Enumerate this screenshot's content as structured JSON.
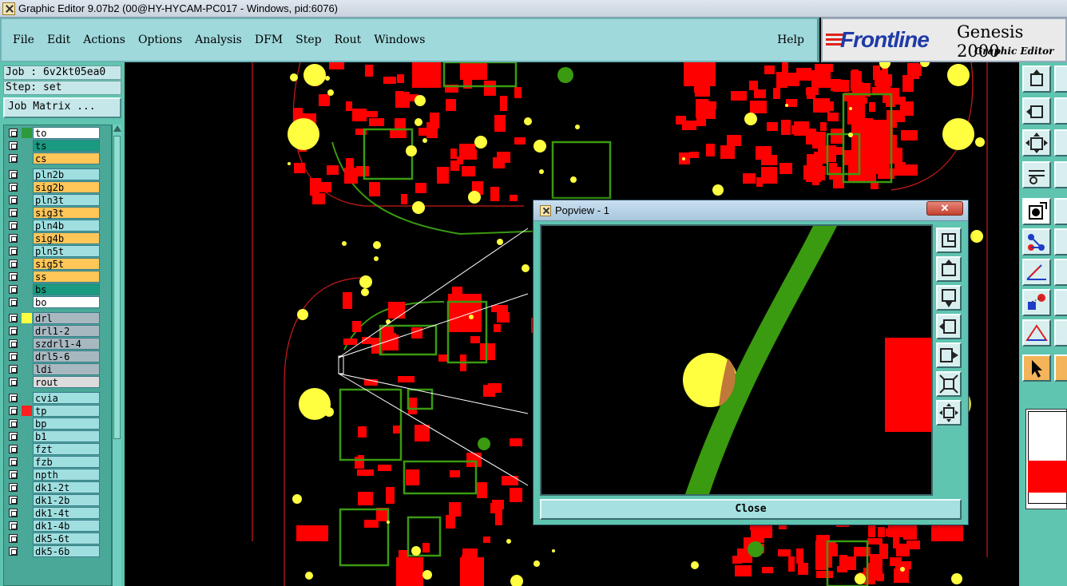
{
  "window": {
    "title": "Graphic Editor 9.07b2 (00@HY-HYCAM-PC017 - Windows, pid:6076)"
  },
  "menu": {
    "items": [
      "File",
      "Edit",
      "Actions",
      "Options",
      "Analysis",
      "DFM",
      "Step",
      "Rout",
      "Windows"
    ],
    "help": "Help"
  },
  "brand": {
    "logo": "Frontline",
    "product": "Genesis 2000",
    "subtitle": "Graphic Editor"
  },
  "job": {
    "job_line": "Job : 6v2kt05ea0",
    "step_line": "Step: set",
    "matrix_button": "Job Matrix ..."
  },
  "layers": [
    {
      "name": "to",
      "color": "#ffffff",
      "swatch": "#2e9a3c"
    },
    {
      "name": "ts",
      "color": "#1a9a80",
      "swatch": ""
    },
    {
      "name": "cs",
      "color": "#ffc658",
      "swatch": ""
    },
    {
      "name": "pln2b",
      "color": "#9fdfe0",
      "swatch": ""
    },
    {
      "name": "sig2b",
      "color": "#ffc658",
      "swatch": ""
    },
    {
      "name": "pln3t",
      "color": "#9fdfe0",
      "swatch": ""
    },
    {
      "name": "sig3t",
      "color": "#ffc658",
      "swatch": ""
    },
    {
      "name": "pln4b",
      "color": "#9fdfe0",
      "swatch": ""
    },
    {
      "name": "sig4b",
      "color": "#ffc658",
      "swatch": ""
    },
    {
      "name": "pln5t",
      "color": "#9fdfe0",
      "swatch": ""
    },
    {
      "name": "sig5t",
      "color": "#ffc658",
      "swatch": ""
    },
    {
      "name": "ss",
      "color": "#ffc658",
      "swatch": ""
    },
    {
      "name": "bs",
      "color": "#1a9a80",
      "swatch": ""
    },
    {
      "name": "bo",
      "color": "#ffffff",
      "swatch": ""
    },
    {
      "name": "drl",
      "color": "#a8b8c0",
      "swatch": "#ffff40"
    },
    {
      "name": "drl1-2",
      "color": "#a8b8c0",
      "swatch": ""
    },
    {
      "name": "szdrl1-4",
      "color": "#a8b8c0",
      "swatch": ""
    },
    {
      "name": "drl5-6",
      "color": "#a8b8c0",
      "swatch": ""
    },
    {
      "name": "ldi",
      "color": "#a8b8c0",
      "swatch": ""
    },
    {
      "name": "rout",
      "color": "#dcdcdc",
      "swatch": ""
    },
    {
      "name": "cvia",
      "color": "#9fdfe0",
      "swatch": ""
    },
    {
      "name": "tp",
      "color": "#9fdfe0",
      "swatch": "#ff2020"
    },
    {
      "name": "bp",
      "color": "#9fdfe0",
      "swatch": ""
    },
    {
      "name": "b1",
      "color": "#9fdfe0",
      "swatch": ""
    },
    {
      "name": "fzt",
      "color": "#9fdfe0",
      "swatch": ""
    },
    {
      "name": "fzb",
      "color": "#9fdfe0",
      "swatch": ""
    },
    {
      "name": "npth",
      "color": "#9fdfe0",
      "swatch": ""
    },
    {
      "name": "dk1-2t",
      "color": "#9fdfe0",
      "swatch": ""
    },
    {
      "name": "dk1-2b",
      "color": "#9fdfe0",
      "swatch": ""
    },
    {
      "name": "dk1-4t",
      "color": "#9fdfe0",
      "swatch": ""
    },
    {
      "name": "dk1-4b",
      "color": "#9fdfe0",
      "swatch": ""
    },
    {
      "name": "dk5-6t",
      "color": "#9fdfe0",
      "swatch": ""
    },
    {
      "name": "dk5-6b",
      "color": "#9fdfe0",
      "swatch": ""
    }
  ],
  "popview": {
    "title": "Popview - 1",
    "close_label": "Close"
  },
  "colors": {
    "pad": "#ff0000",
    "trace": "#3a9a10",
    "drill": "#ffff40",
    "outline": "#cc1a1a",
    "background": "#000000"
  }
}
